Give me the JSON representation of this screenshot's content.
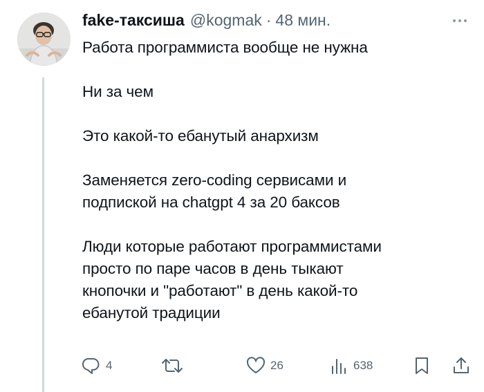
{
  "author": {
    "display_name": "fake-таксиша",
    "handle": "@kogmak",
    "separator": "·",
    "time": "48 мин."
  },
  "tweet": {
    "paragraphs": [
      "Работа программиста вообще не нужна",
      "Ни за чем",
      "Это какой-то ебанутый анархизм",
      "Заменяется zero-coding сервисами и\nподпиской на chatgpt 4 за 20 баксов",
      "Люди которые работают программистами\nпросто по паре часов в день тыкают\nкнопочки и \"работают\" в день какой-то\nебанутой традиции"
    ]
  },
  "actions": {
    "replies": "4",
    "likes": "26",
    "views": "638"
  },
  "icons": {
    "more": "more-icon",
    "reply": "reply-icon",
    "retweet": "retweet-icon",
    "like": "heart-icon",
    "views": "views-icon",
    "bookmark": "bookmark-icon",
    "share": "share-icon"
  },
  "colors": {
    "text": "#0f1419",
    "secondary": "#536471",
    "thread_line": "#cfd9de"
  }
}
